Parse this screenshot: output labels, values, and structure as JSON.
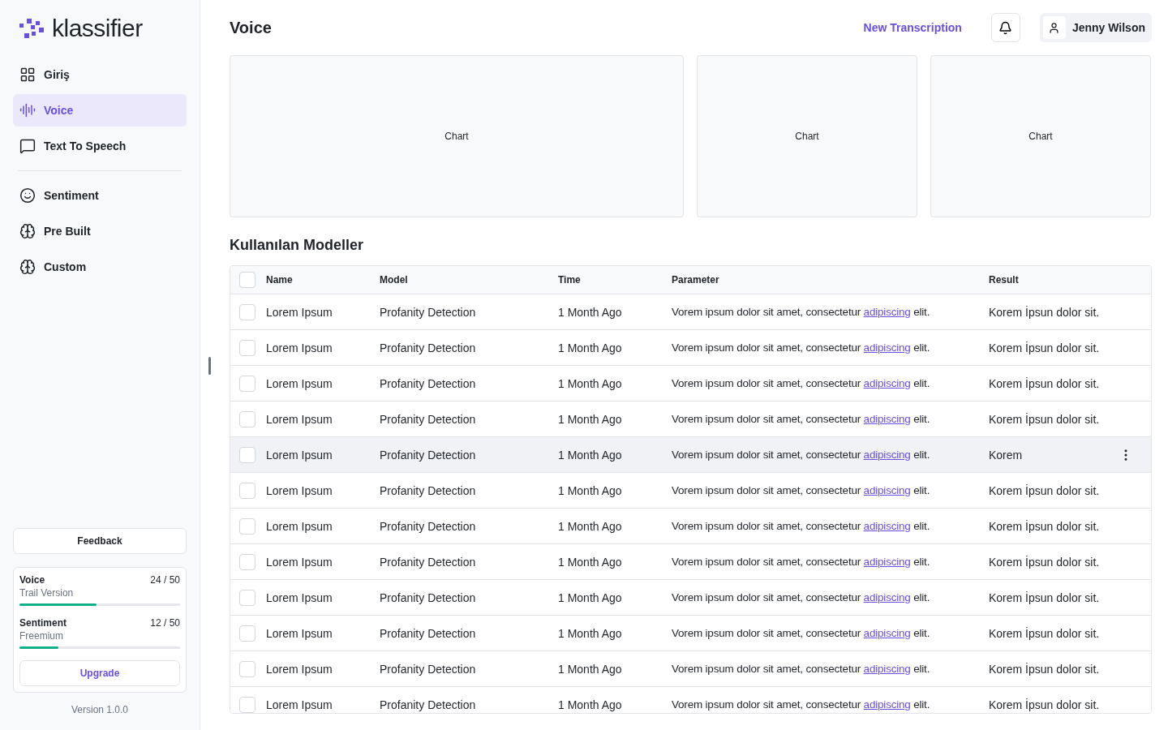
{
  "brand": {
    "name": "klassifier"
  },
  "nav_groups": [
    [
      {
        "label": "Giriş",
        "selected": false
      },
      {
        "label": "Voice",
        "selected": true
      },
      {
        "label": "Text To Speech",
        "selected": false
      }
    ],
    [
      {
        "label": "Sentiment",
        "selected": false
      },
      {
        "label": "Pre Built",
        "selected": false
      },
      {
        "label": "Custom",
        "selected": false
      }
    ]
  ],
  "feedback": "Feedback",
  "usage": [
    {
      "name": "Voice",
      "plan": "Trail Version",
      "count": "24 / 50",
      "level": 0.48
    },
    {
      "name": "Sentiment",
      "plan": "Freemium",
      "count": "12 / 50",
      "level": 0.24
    }
  ],
  "upgrade": "Upgrade",
  "version": "Version 1.0.0",
  "header": {
    "title": "Voice",
    "action": "New Transcription",
    "user": "Jenny Wilson"
  },
  "charts": [
    "Chart",
    "Chart",
    "Chart"
  ],
  "section_title": "Kullanılan Modeller",
  "table": {
    "columns": [
      "Name",
      "Model",
      "Time",
      "Parameter",
      "Result"
    ],
    "header_checked": false,
    "rows": [
      {
        "name": "Lorem Ipsum",
        "model": "Profanity Detection",
        "time": "1 Month Ago",
        "parameter": [
          "Vorem ipsum dolor sit amet, consectetur ",
          "adipiscing",
          " elit."
        ],
        "result": "Korem İpsun dolor sit.",
        "checked": false,
        "hovered": false
      },
      {
        "name": "Lorem Ipsum",
        "model": "Profanity Detection",
        "time": "1 Month Ago",
        "parameter": [
          "Vorem ipsum dolor sit amet, consectetur ",
          "adipiscing",
          " elit."
        ],
        "result": "Korem İpsun dolor sit.",
        "checked": false,
        "hovered": false
      },
      {
        "name": "Lorem Ipsum",
        "model": "Profanity Detection",
        "time": "1 Month Ago",
        "parameter": [
          "Vorem ipsum dolor sit amet, consectetur ",
          "adipiscing",
          " elit."
        ],
        "result": "Korem İpsun dolor sit.",
        "checked": false,
        "hovered": false
      },
      {
        "name": "Lorem Ipsum",
        "model": "Profanity Detection",
        "time": "1 Month Ago",
        "parameter": [
          "Vorem ipsum dolor sit amet, consectetur ",
          "adipiscing",
          " elit."
        ],
        "result": "Korem İpsun dolor sit.",
        "checked": false,
        "hovered": false
      },
      {
        "name": "Lorem Ipsum",
        "model": "Profanity Detection",
        "time": "1 Month Ago",
        "parameter": [
          "Vorem ipsum dolor sit amet, consectetur ",
          "adipiscing",
          " elit."
        ],
        "result": "Korem",
        "checked": false,
        "hovered": true
      },
      {
        "name": "Lorem Ipsum",
        "model": "Profanity Detection",
        "time": "1 Month Ago",
        "parameter": [
          "Vorem ipsum dolor sit amet, consectetur ",
          "adipiscing",
          " elit."
        ],
        "result": "Korem İpsun dolor sit.",
        "checked": false,
        "hovered": false
      },
      {
        "name": "Lorem Ipsum",
        "model": "Profanity Detection",
        "time": "1 Month Ago",
        "parameter": [
          "Vorem ipsum dolor sit amet, consectetur ",
          "adipiscing",
          " elit."
        ],
        "result": "Korem İpsun dolor sit.",
        "checked": false,
        "hovered": false
      },
      {
        "name": "Lorem Ipsum",
        "model": "Profanity Detection",
        "time": "1 Month Ago",
        "parameter": [
          "Vorem ipsum dolor sit amet, consectetur ",
          "adipiscing",
          " elit."
        ],
        "result": "Korem İpsun dolor sit.",
        "checked": false,
        "hovered": false
      },
      {
        "name": "Lorem Ipsum",
        "model": "Profanity Detection",
        "time": "1 Month Ago",
        "parameter": [
          "Vorem ipsum dolor sit amet, consectetur ",
          "adipiscing",
          " elit."
        ],
        "result": "Korem İpsun dolor sit.",
        "checked": false,
        "hovered": false
      },
      {
        "name": "Lorem Ipsum",
        "model": "Profanity Detection",
        "time": "1 Month Ago",
        "parameter": [
          "Vorem ipsum dolor sit amet, consectetur ",
          "adipiscing",
          " elit."
        ],
        "result": "Korem İpsun dolor sit.",
        "checked": false,
        "hovered": false
      },
      {
        "name": "Lorem Ipsum",
        "model": "Profanity Detection",
        "time": "1 Month Ago",
        "parameter": [
          "Vorem ipsum dolor sit amet, consectetur ",
          "adipiscing",
          " elit."
        ],
        "result": "Korem İpsun dolor sit.",
        "checked": false,
        "hovered": false
      },
      {
        "name": "Lorem Ipsum",
        "model": "Profanity Detection",
        "time": "1 Month Ago",
        "parameter": [
          "Vorem ipsum dolor sit amet, consectetur ",
          "adipiscing",
          " elit."
        ],
        "result": "Korem İpsun dolor sit.",
        "checked": false,
        "hovered": false
      }
    ]
  }
}
